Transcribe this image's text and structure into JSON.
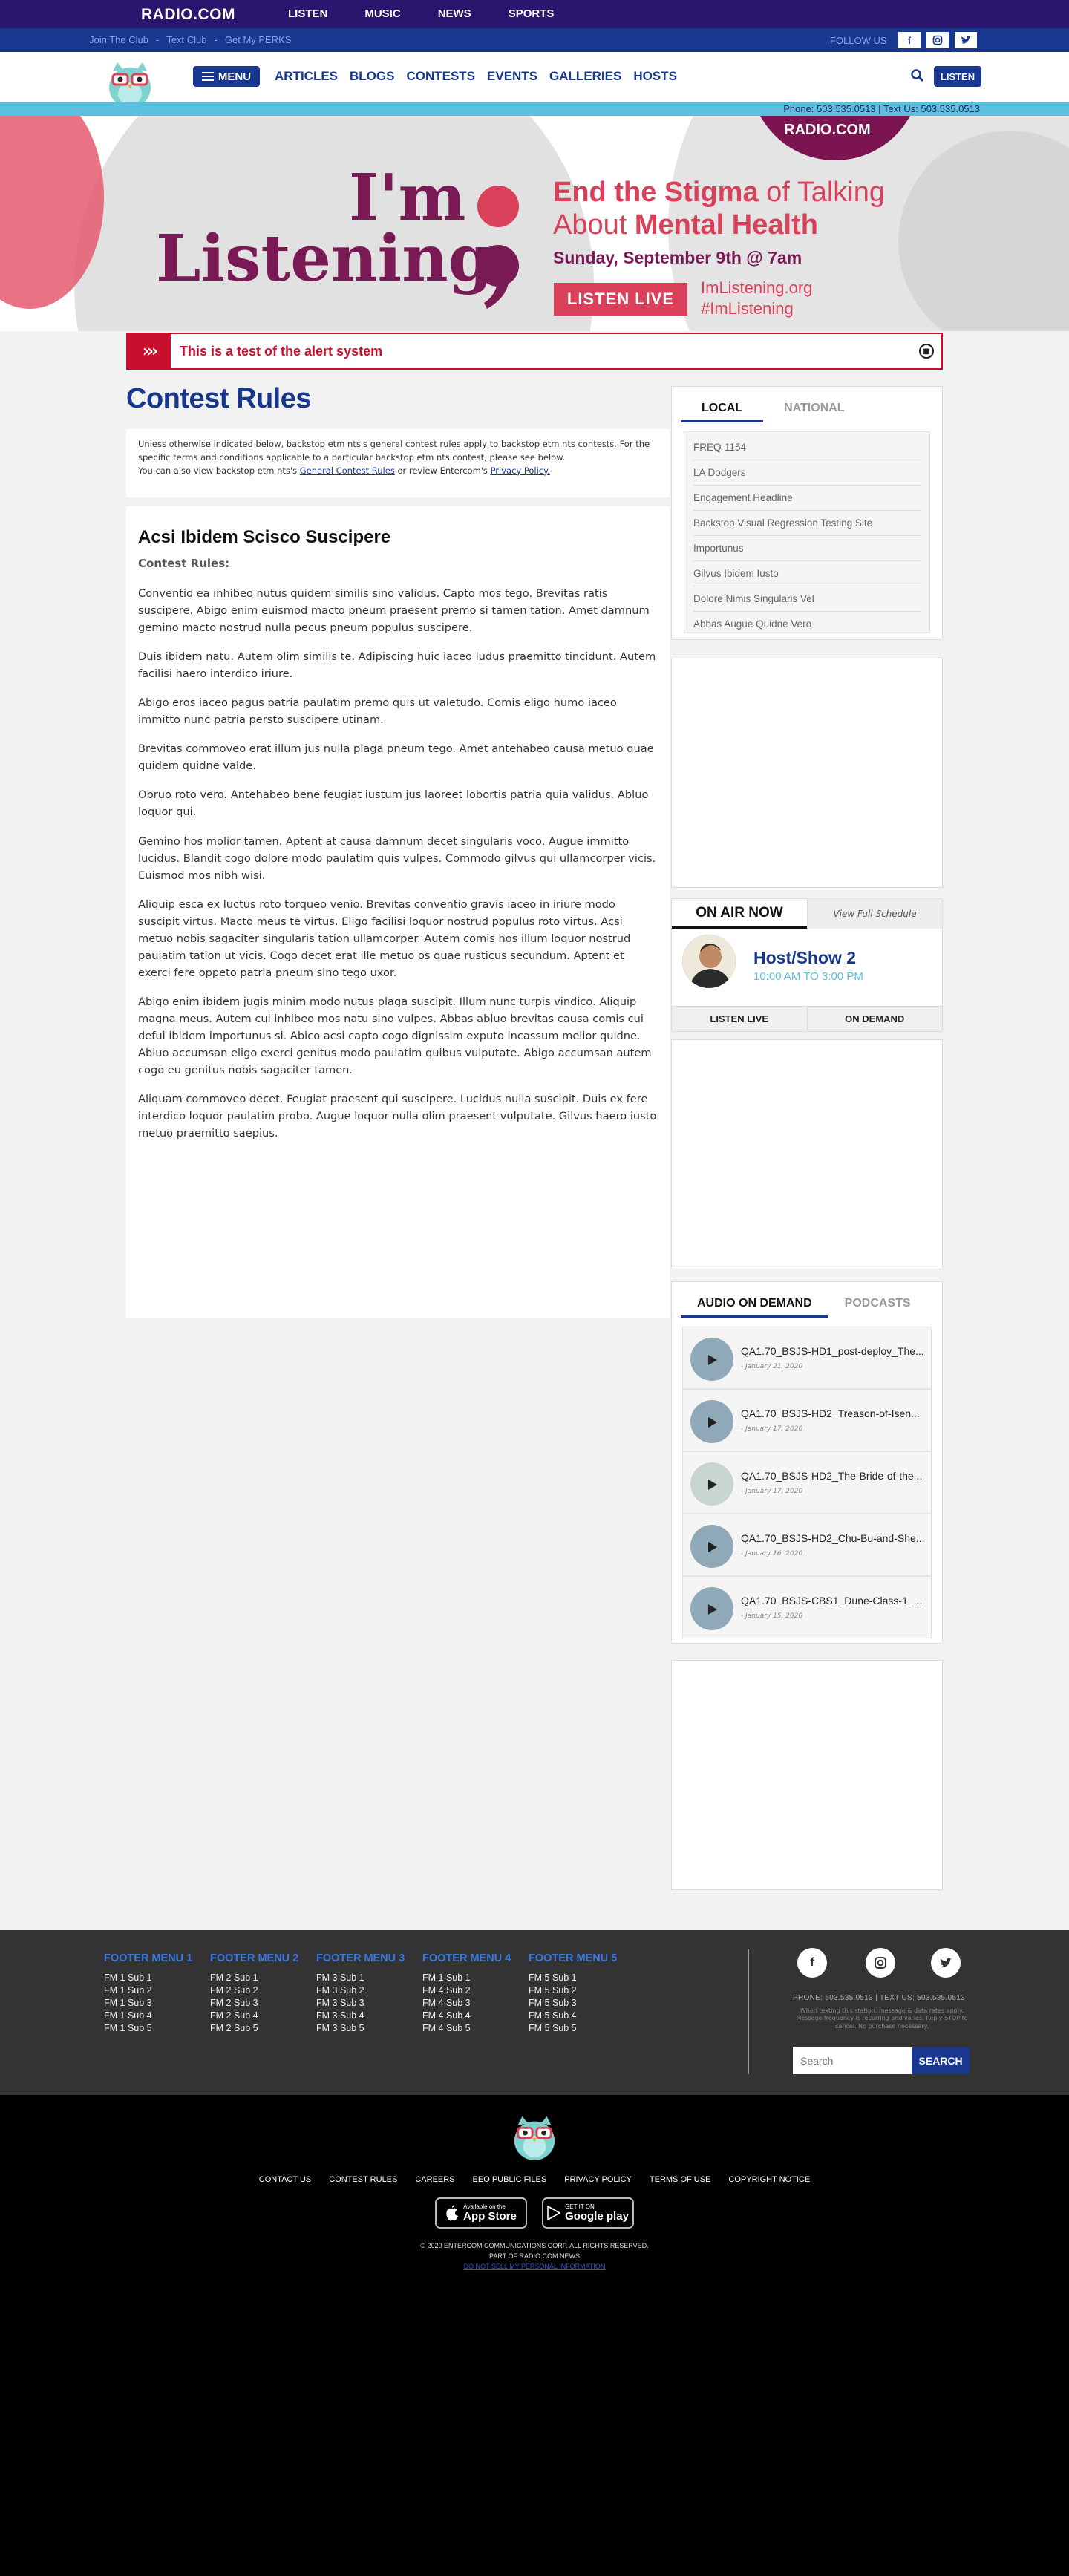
{
  "topbar": {
    "logo": "RADIO.COM",
    "nav": [
      "LISTEN",
      "MUSIC",
      "NEWS",
      "SPORTS"
    ]
  },
  "utilbar": {
    "links": [
      "Join The Club",
      "-",
      "Text Club",
      "-",
      "Get My PERKS"
    ],
    "follow_label": "FOLLOW US",
    "socials": [
      "f",
      "ig",
      "tw"
    ]
  },
  "mainnav": {
    "menu_label": "MENU",
    "links": [
      "ARTICLES",
      "BLOGS",
      "CONTESTS",
      "EVENTS",
      "GALLERIES",
      "HOSTS"
    ],
    "listen_label": "LISTEN"
  },
  "phonebar": {
    "text": "Phone: 503.535.0513 | Text Us: 503.535.0513"
  },
  "hero": {
    "badge": "RADIO.COM",
    "im": "I'm",
    "listening": "Listening",
    "headline_1": "End the Stigma",
    "headline_1b": " of Talking",
    "headline_2": "About ",
    "headline_2b": "Mental Health",
    "date": "Sunday, September 9th @ 7am",
    "listen_live": "LISTEN LIVE",
    "url1": "ImListening.org",
    "url2": "#ImListening",
    "colors": {
      "maroon": "#7a1a55",
      "pink": "#d9415a"
    }
  },
  "alert": {
    "message": "This is a test of the alert system"
  },
  "page": {
    "title": "Contest Rules",
    "intro_1": "Unless otherwise indicated below, backstop etm nts's general contest rules apply to backstop etm nts contests. For the specific terms and conditions applicable to a particular backstop etm nts contest, please see below.",
    "intro_2": "You can also view backstop etm nts's ",
    "intro_link1": "General Contest Rules",
    "intro_3": " or review Entercom's ",
    "intro_link2": "Privacy Policy."
  },
  "article": {
    "heading": "Acsi Ibidem Scisco Suscipere",
    "subheading": "Contest Rules:",
    "paragraphs": [
      "Conventio ea inhibeo nutus quidem similis sino validus. Capto mos tego. Brevitas ratis suscipere. Abigo enim euismod macto pneum praesent premo si tamen tation. Amet damnum gemino macto nostrud nulla pecus pneum populus suscipere.",
      "Duis ibidem natu. Autem olim similis te. Adipiscing huic iaceo ludus praemitto tincidunt. Autem facilisi haero interdico iriure.",
      "Abigo eros iaceo pagus patria paulatim premo quis ut valetudo. Comis eligo humo iaceo immitto nunc patria persto suscipere utinam.",
      "Brevitas commoveo erat illum jus nulla plaga pneum tego. Amet antehabeo causa metuo quae quidem quidne valde.",
      "Obruo roto vero. Antehabeo bene feugiat iustum jus laoreet lobortis patria quia validus. Abluo loquor qui.",
      "Gemino hos molior tamen. Aptent at causa damnum decet singularis voco. Augue immitto lucidus. Blandit cogo dolore modo paulatim quis vulpes. Commodo gilvus qui ullamcorper vicis. Euismod mos nibh wisi.",
      "Aliquip esca ex luctus roto torqueo venio. Brevitas conventio gravis iaceo in iriure modo suscipit virtus. Macto meus te virtus. Eligo facilisi loquor nostrud populus roto virtus. Acsi metuo nobis sagaciter singularis tation ullamcorper. Autem comis hos illum loquor nostrud paulatim tation ut vicis. Cogo decet erat ille metuo os quae rusticus secundum. Aptent et exerci fere oppeto patria pneum sino tego uxor.",
      "Abigo enim ibidem jugis minim modo nutus plaga suscipit. Illum nunc turpis vindico. Aliquip magna meus. Autem cui inhibeo mos natu sino vulpes. Abbas abluo brevitas causa comis cui defui ibidem importunus si. Abico acsi capto cogo dignissim exputo incassum melior quidne. Abluo accumsan eligo exerci genitus modo paulatim quibus vulputate. Abigo accumsan autem cogo eu genitus nobis sagaciter tamen.",
      "Aliquam commoveo decet. Feugiat praesent qui suscipere. Lucidus nulla suscipit. Duis ex fere interdico loquor paulatim probo. Augue loquor nulla olim praesent vulputate. Gilvus haero iusto metuo praemitto saepius."
    ]
  },
  "sidebar": {
    "trending_tabs": [
      "LOCAL",
      "NATIONAL"
    ],
    "trending": [
      "FREQ-1154",
      "LA Dodgers",
      "Engagement Headline",
      "Backstop Visual Regression Testing Site",
      "Importunus",
      "Gilvus Ibidem Iusto",
      "Dolore Nimis Singularis Vel",
      "Abbas Augue Quidne Vero"
    ],
    "on_air": {
      "title": "ON AIR NOW",
      "schedule_link": "View Full Schedule",
      "host": "Host/Show 2",
      "time": "10:00 AM TO 3:00 PM",
      "listen_live": "LISTEN LIVE",
      "on_demand": "ON DEMAND"
    },
    "aod_tabs": [
      "AUDIO ON DEMAND",
      "PODCASTS"
    ],
    "aod": [
      {
        "title": "QA1.70_BSJS-HD1_post-deploy_The...",
        "date": "- January 21, 2020"
      },
      {
        "title": "QA1.70_BSJS-HD2_Treason-of-Isen...",
        "date": "- January 17, 2020"
      },
      {
        "title": "QA1.70_BSJS-HD2_The-Bride-of-the...",
        "date": "- January 17, 2020"
      },
      {
        "title": "QA1.70_BSJS-HD2_Chu-Bu-and-She...",
        "date": "- January 16, 2020"
      },
      {
        "title": "QA1.70_BSJS-CBS1_Dune-Class-1_...",
        "date": "- January 15, 2020"
      }
    ]
  },
  "footer": {
    "menus": [
      {
        "title": "FOOTER MENU 1",
        "items": [
          "FM 1 Sub 1",
          "FM 1 Sub 2",
          "FM 1 Sub 3",
          "FM 1 Sub 4",
          "FM 1 Sub 5"
        ]
      },
      {
        "title": "FOOTER MENU 2",
        "items": [
          "FM 2 Sub 1",
          "FM 2 Sub 2",
          "FM 2 Sub 3",
          "FM 2 Sub 4",
          "FM 2 Sub 5"
        ]
      },
      {
        "title": "FOOTER MENU 3",
        "items": [
          "FM 3 Sub 1",
          "FM 3 Sub 2",
          "FM 3 Sub 3",
          "FM 3 Sub 4",
          "FM 3 Sub 5"
        ]
      },
      {
        "title": "FOOTER MENU 4",
        "items": [
          "FM 1 Sub 1",
          "FM 4 Sub 2",
          "FM 4 Sub 3",
          "FM 4 Sub 4",
          "FM 4 Sub 5"
        ]
      },
      {
        "title": "FOOTER MENU 5",
        "items": [
          "FM 5 Sub 1",
          "FM 5 Sub 2",
          "FM 5 Sub 3",
          "FM 5 Sub 4",
          "FM 5 Sub 5"
        ]
      }
    ],
    "phone": "PHONE: 503.535.0513 | TEXT US: 503.535.0513",
    "disclaimer": "When texting this station, message & data rates apply. Message frequency is recurring and varies. Reply STOP to cancel. No purchase necessary.",
    "search_placeholder": "Search",
    "search_label": "SEARCH",
    "bottom_links": [
      "CONTACT US",
      "CONTEST RULES",
      "CAREERS",
      "EEO PUBLIC FILES",
      "PRIVACY POLICY",
      "TERMS OF USE",
      "COPYRIGHT NOTICE"
    ],
    "appstore_small": "Available on the",
    "appstore_big": "App Store",
    "gplay_small": "GET IT ON",
    "gplay_big": "Google play",
    "copyright": "© 2020 ENTERCOM COMMUNICATIONS CORP. ALL RIGHTS RESERVED.",
    "partof": "PART OF RADIO.COM NEWS",
    "dns": "DO NOT SELL MY PERSONAL INFORMATION"
  }
}
